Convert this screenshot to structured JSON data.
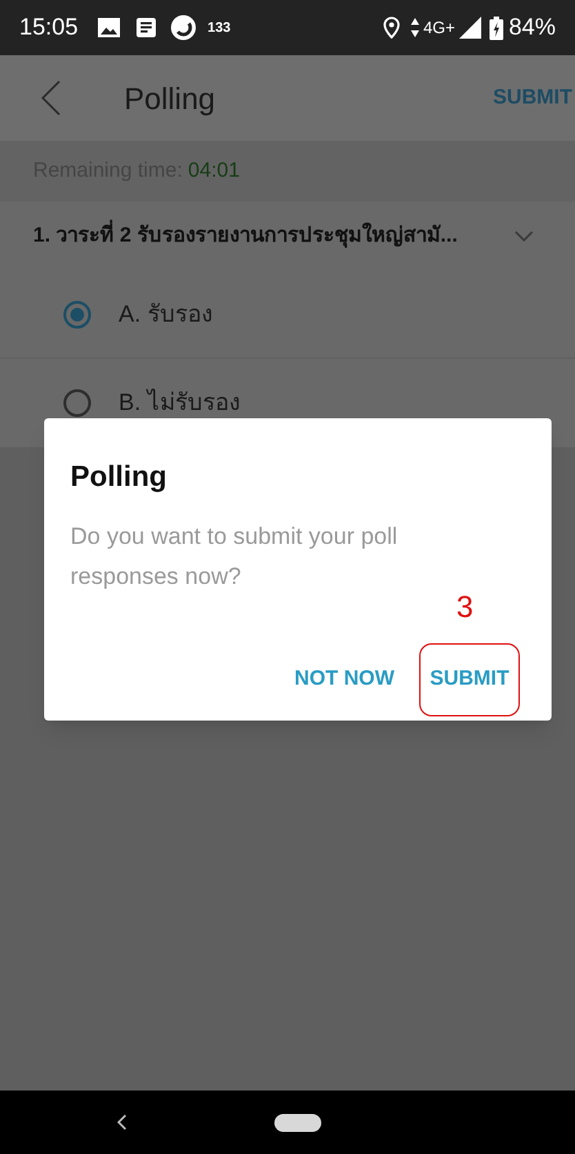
{
  "status_bar": {
    "time": "15:05",
    "notification_count": "133",
    "network": "4G+",
    "battery": "84%"
  },
  "app_bar": {
    "title": "Polling",
    "action": "SUBMIT"
  },
  "remaining": {
    "label": "Remaining time:",
    "value": "04:01"
  },
  "question": {
    "text": "1. วาระที่ 2  รับรองรายงานการประชุมใหญ่สามั...",
    "expanded": false
  },
  "options": [
    {
      "label": "A. รับรอง",
      "selected": true
    },
    {
      "label": "B. ไม่รับรอง",
      "selected": false
    }
  ],
  "dialog": {
    "title": "Polling",
    "message": "Do you want to submit your poll responses now?",
    "buttons": [
      {
        "label": "NOT NOW",
        "highlighted": false
      },
      {
        "label": "SUBMIT",
        "highlighted": true
      }
    ]
  },
  "annotation": {
    "label": "3"
  }
}
